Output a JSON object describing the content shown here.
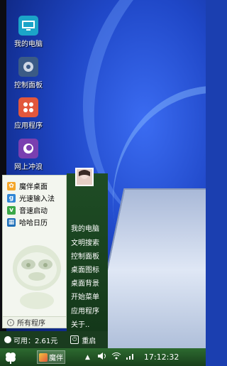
{
  "desktop": {
    "icons": [
      {
        "label": "我的电脑",
        "icon": "computer-icon"
      },
      {
        "label": "控制面板",
        "icon": "gear-icon"
      },
      {
        "label": "应用程序",
        "icon": "apps-icon"
      },
      {
        "label": "网上冲浪",
        "icon": "browser-icon"
      }
    ]
  },
  "start_menu": {
    "left_items": [
      {
        "label": "魔伴桌面",
        "icon": "flower-icon"
      },
      {
        "label": "光速输入法",
        "icon": "input-method-icon"
      },
      {
        "label": "音速启动",
        "icon": "launcher-icon"
      },
      {
        "label": "哈哈日历",
        "icon": "calendar-icon"
      }
    ],
    "all_programs": "所有程序",
    "right_items": [
      "我的电脑",
      "文明搜索",
      "控制面板",
      "桌面图标",
      "桌面背景",
      "开始菜单",
      "应用程序",
      "关于.."
    ],
    "memory_label": "可用：2.61元",
    "restart_label": "重启"
  },
  "taskbar": {
    "task_label": "魔伴",
    "clock": "17:12:32"
  },
  "colors": {
    "taskbar": "#1f4d25",
    "desktop": "#1f47c7"
  }
}
